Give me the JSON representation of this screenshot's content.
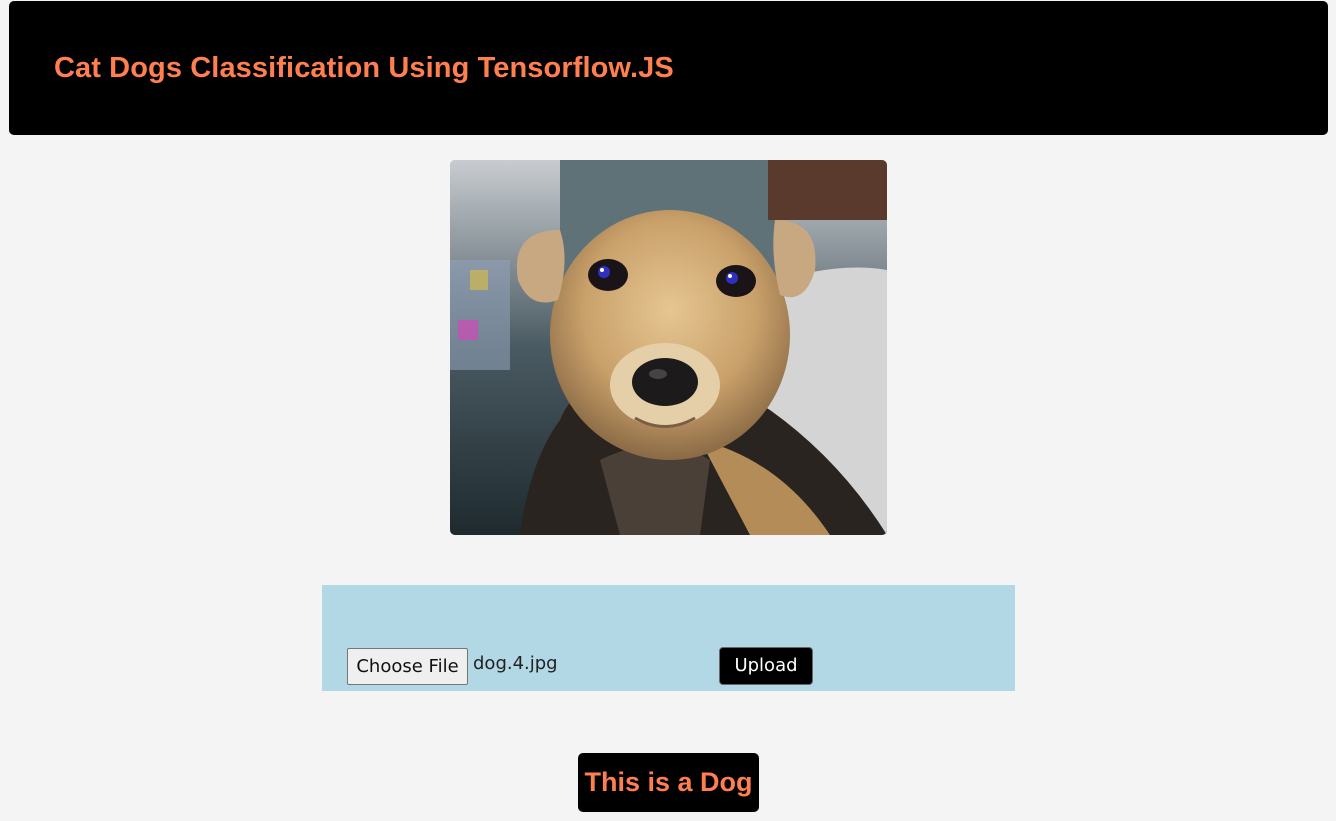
{
  "header": {
    "title": "Cat Dogs Classification Using Tensorflow.JS"
  },
  "preview": {
    "subject": "dog-photo"
  },
  "upload": {
    "choose_label": "Choose File",
    "file_name": "dog.4.jpg",
    "upload_label": "Upload"
  },
  "result": {
    "text": "This is a Dog"
  },
  "colors": {
    "background": "#f4f4f4",
    "header_bg": "#000000",
    "accent": "#ff7f50",
    "panel": "#b2d8e5"
  }
}
